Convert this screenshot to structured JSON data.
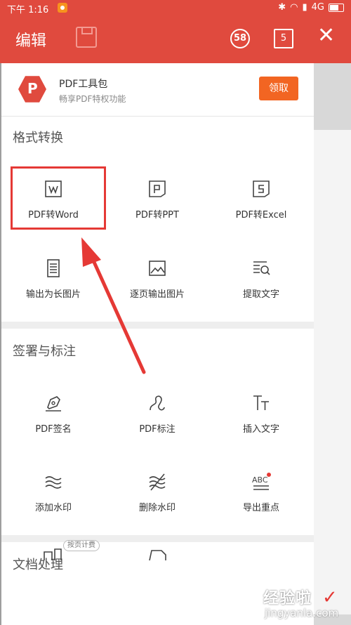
{
  "status": {
    "time": "下午 1:16",
    "network": "4G"
  },
  "toolbar": {
    "title": "编辑",
    "badge": "58",
    "tabs": "5"
  },
  "promo": {
    "name": "PDF工具包",
    "subtitle": "畅享PDF特权功能",
    "claim": "领取"
  },
  "sections": {
    "convert": {
      "title": "格式转换",
      "items": [
        "PDF转Word",
        "PDF转PPT",
        "PDF转Excel",
        "输出为长图片",
        "逐页输出图片",
        "提取文字"
      ]
    },
    "sign": {
      "title": "签署与标注",
      "items": [
        "PDF签名",
        "PDF标注",
        "插入文字",
        "添加水印",
        "删除水印",
        "导出重点"
      ]
    },
    "doc": {
      "title": "文档处理",
      "pay_badge": "按页计费"
    }
  },
  "watermark": {
    "line1": "经验啦",
    "line2": "jingyanla.com"
  },
  "colors": {
    "brand": "#e04a3e",
    "claim": "#f26522",
    "annotation": "#e53935"
  }
}
